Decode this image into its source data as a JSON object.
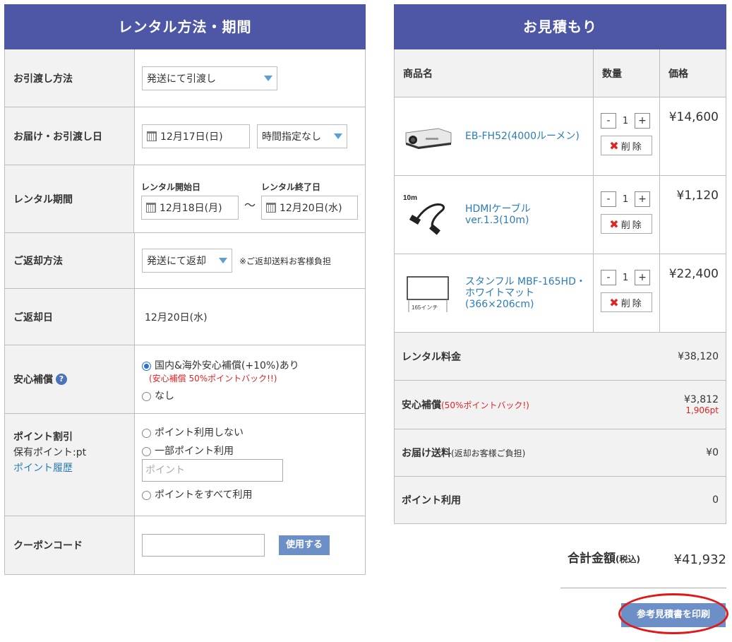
{
  "left": {
    "title": "レンタル方法・期間",
    "delivery_method": {
      "label": "お引渡し方法",
      "value": "発送にて引渡し"
    },
    "delivery_date": {
      "label": "お届け・お引渡し日",
      "date": "12月17日(日)",
      "time": "時間指定なし"
    },
    "rental_period": {
      "label": "レンタル期間",
      "start_label": "レンタル開始日",
      "start": "12月18日(月)",
      "tilde": "〜",
      "end_label": "レンタル終了日",
      "end": "12月20日(水)"
    },
    "return_method": {
      "label": "ご返却方法",
      "value": "発送にて返却",
      "note": "※ご返却送料お客様負担"
    },
    "return_date": {
      "label": "ご返却日",
      "value": "12月20日(水)"
    },
    "insurance": {
      "label": "安心補償",
      "option1": "国内&海外安心補償(+10%)あり",
      "option1_note": "(安心補償 50%ポイントバック!!)",
      "option2": "なし"
    },
    "points": {
      "label": "ポイント割引",
      "held": "保有ポイント:pt",
      "history_link": "ポイント履歴",
      "opt_none": "ポイント利用しない",
      "opt_partial": "一部ポイント利用",
      "placeholder": "ポイント",
      "opt_all": "ポイントをすべて利用"
    },
    "coupon": {
      "label": "クーポンコード",
      "button": "使用する"
    }
  },
  "right": {
    "title": "お見積もり",
    "columns": {
      "product": "商品名",
      "qty": "数量",
      "price": "価格"
    },
    "items": [
      {
        "name": "EB-FH52(4000ルーメン)",
        "qty": "1",
        "price": "¥14,600",
        "icon": "projector-image"
      },
      {
        "name": "HDMIケーブルver.1.3(10m)",
        "qty": "1",
        "price": "¥1,120",
        "icon": "hdmi-cable-image",
        "img_text": "10m"
      },
      {
        "name": "スタンフル MBF-165HD・ホワイトマット(366×206cm)",
        "qty": "1",
        "price": "¥22,400",
        "icon": "screen-image",
        "img_text": "165インチ"
      }
    ],
    "minus": "-",
    "plus": "+",
    "delete_label": "削除",
    "summary": {
      "rental_fee": {
        "label": "レンタル料金",
        "value": "¥38,120"
      },
      "insurance": {
        "label": "安心補償",
        "note": "(50%ポイントバック!)",
        "value": "¥3,812",
        "sub": "1,906pt"
      },
      "shipping": {
        "label": "お届け送料",
        "note": "(返却お客様ご負担)",
        "value": "¥0"
      },
      "points": {
        "label": "ポイント利用",
        "value": "0"
      }
    },
    "total": {
      "label": "合計金額",
      "label_small": "(税込)",
      "value": "¥41,932"
    },
    "print_button": "参考見積書を印刷"
  },
  "colors": {
    "header": "#4d57a6",
    "link": "#2a7cb8",
    "button": "#6d8fc7",
    "alert": "#e02424"
  }
}
